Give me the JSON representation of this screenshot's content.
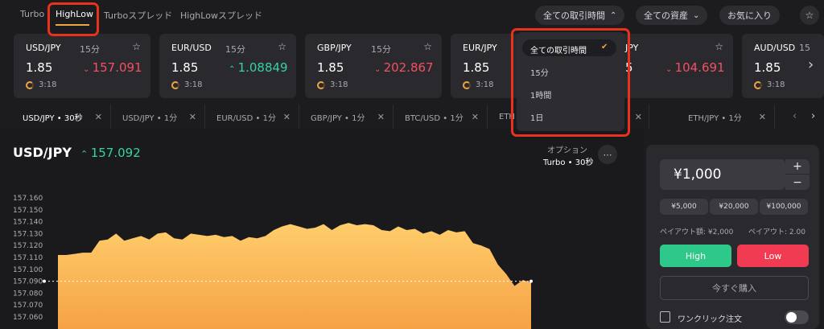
{
  "nav": {
    "tabs": [
      "Turbo",
      "HighLow",
      "Turboスプレッド",
      "HighLowスプレッド"
    ],
    "time_filter": "全ての取引時間",
    "asset_filter": "全ての資産",
    "favorites": "お気に入り"
  },
  "cards": [
    {
      "pair": "USD/JPY",
      "duration": "15分",
      "payout": "1.85",
      "price": "157.091",
      "direction": "down",
      "time": "3:18"
    },
    {
      "pair": "EUR/USD",
      "duration": "15分",
      "payout": "1.85",
      "price": "1.08849",
      "direction": "up",
      "time": "3:18"
    },
    {
      "pair": "GBP/JPY",
      "duration": "15分",
      "payout": "1.85",
      "price": "202.867",
      "direction": "down",
      "time": "3:18"
    },
    {
      "pair": "EUR/JPY",
      "duration": "",
      "payout": "1.85",
      "price": "",
      "direction": "",
      "time": "3:18"
    },
    {
      "pair": "JPY",
      "duration": "",
      "payout": "5",
      "price": "104.691",
      "direction": "down",
      "time": "3:18"
    },
    {
      "pair": "AUD/USD",
      "duration": "15",
      "payout": "1.85",
      "price": "",
      "direction": "",
      "time": "3:18"
    }
  ],
  "asset_tabs": [
    "USD/JPY • 30秒",
    "USD/JPY • 1分",
    "EUR/USD • 1分",
    "GBP/JPY • 1分",
    "BTC/USD • 1分",
    "ETH",
    "ETH/JPY • 1分"
  ],
  "chart_header": {
    "pair": "USD/JPY",
    "price": "157.092",
    "option_label": "オプション",
    "option_value": "Turbo • 30秒"
  },
  "chart_data": {
    "type": "area",
    "y_ticks": [
      "157.160",
      "157.150",
      "157.140",
      "157.130",
      "157.120",
      "157.110",
      "157.100",
      "157.090",
      "157.080",
      "157.070",
      "157.060"
    ],
    "ylim": [
      157.06,
      157.16
    ],
    "current_level": 157.09,
    "values": [
      157.112,
      157.112,
      157.113,
      157.114,
      157.114,
      157.124,
      157.125,
      157.13,
      157.124,
      157.126,
      157.128,
      157.125,
      157.13,
      157.131,
      157.126,
      157.125,
      157.13,
      157.129,
      157.128,
      157.129,
      157.127,
      157.128,
      157.124,
      157.127,
      157.126,
      157.128,
      157.133,
      157.136,
      157.138,
      157.136,
      157.134,
      157.135,
      157.138,
      157.133,
      157.137,
      157.139,
      157.137,
      157.138,
      157.137,
      157.133,
      157.132,
      157.136,
      157.133,
      157.134,
      157.13,
      157.132,
      157.129,
      157.133,
      157.131,
      157.132,
      157.122,
      157.12,
      157.117,
      157.104,
      157.096,
      157.086,
      157.091,
      157.089
    ]
  },
  "trade": {
    "amount": "¥1,000",
    "plus": "+",
    "minus": "−",
    "quick_amounts": [
      "¥5,000",
      "¥20,000",
      "¥100,000"
    ],
    "payout_amount": "ペイアウト額: ¥2,000",
    "payout_rate": "ペイアウト: 2.00",
    "high": "High",
    "low": "Low",
    "buy_now": "今すぐ購入",
    "one_click": "ワンクリック注文"
  },
  "dropdown": {
    "items": [
      "全ての取引時間",
      "15分",
      "1時間",
      "1日"
    ],
    "selected": 0
  },
  "colors": {
    "up": "#34d3a0",
    "down": "#f44f63",
    "accent": "#f0a640",
    "highlight": "#e8321e"
  },
  "icons": [
    "star-icon",
    "chevron-down-icon",
    "chevron-up-icon",
    "arrow-up-icon",
    "arrow-down-icon",
    "clock-icon",
    "close-icon",
    "chevron-right-icon",
    "more-icon",
    "check-icon"
  ]
}
